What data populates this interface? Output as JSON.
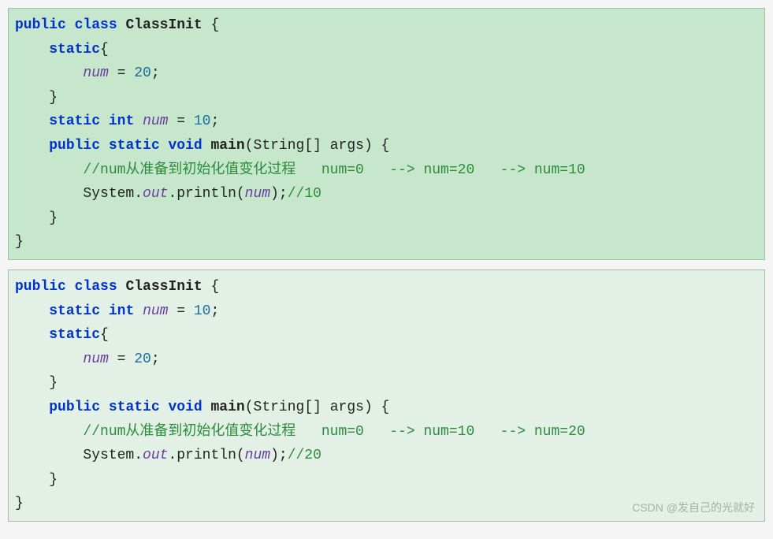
{
  "block1": {
    "l1_public": "public",
    "l1_class": "class",
    "l1_name": "ClassInit",
    "l1_brace": " {",
    "l2_static": "static",
    "l2_brace": "{",
    "l3_num": "num",
    "l3_eq": " = ",
    "l3_val": "20",
    "l3_semi": ";",
    "l4_brace": "}",
    "l5_static": "static",
    "l5_int": "int",
    "l5_num": "num",
    "l5_eq": " = ",
    "l5_val": "10",
    "l5_semi": ";",
    "l6_public": "public",
    "l6_static": "static",
    "l6_void": "void",
    "l6_main": "main",
    "l6_paren": "(String[] args) {",
    "l7_cmt": "//num从准备到初始化值变化过程   num=0   --> num=20   --> num=10",
    "l8_sys": "System.",
    "l8_out": "out",
    "l8_print": ".println(",
    "l8_num": "num",
    "l8_close": ");",
    "l8_cmt": "//10",
    "l9_brace": "}",
    "l10_brace": "}"
  },
  "block2": {
    "l1_public": "public",
    "l1_class": "class",
    "l1_name": "ClassInit",
    "l1_brace": " {",
    "l2_static": "static",
    "l2_int": "int",
    "l2_num": "num",
    "l2_eq": " = ",
    "l2_val": "10",
    "l2_semi": ";",
    "l3_static": "static",
    "l3_brace": "{",
    "l4_num": "num",
    "l4_eq": " = ",
    "l4_val": "20",
    "l4_semi": ";",
    "l5_brace": "}",
    "l6_public": "public",
    "l6_static": "static",
    "l6_void": "void",
    "l6_main": "main",
    "l6_paren": "(String[] args) {",
    "l7_cmt": "//num从准备到初始化值变化过程   num=0   --> num=10   --> num=20",
    "l8_sys": "System.",
    "l8_out": "out",
    "l8_print": ".println(",
    "l8_num": "num",
    "l8_close": ");",
    "l8_cmt": "//20",
    "l9_brace": "}",
    "l10_brace": "}"
  },
  "watermark": "CSDN @发自己的光就好"
}
